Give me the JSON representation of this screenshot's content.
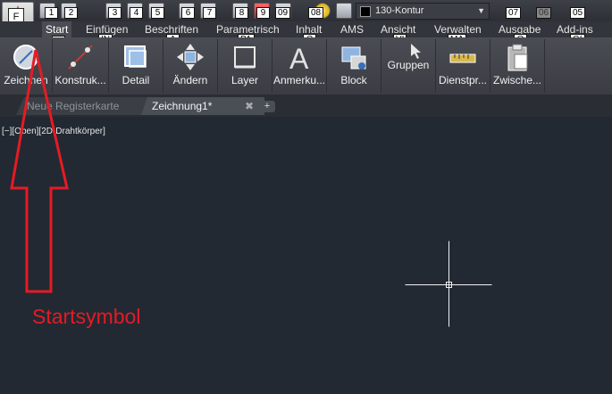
{
  "app_button": {
    "keytip": "F",
    "sub_keytip": "M"
  },
  "qat": {
    "keytips": [
      "1",
      "2",
      "3",
      "4",
      "5",
      "6",
      "7",
      "8",
      "9",
      "09",
      "08"
    ],
    "layer": {
      "name": "130-Kontur",
      "swatch": "#000000"
    },
    "right_keytips": [
      "07",
      "06",
      "05"
    ]
  },
  "ribbon": {
    "tabs": [
      {
        "label": "Start",
        "keytip": "H",
        "active": true
      },
      {
        "label": "Einfügen",
        "keytip": "IN"
      },
      {
        "label": "Beschriften",
        "keytip": "A"
      },
      {
        "label": "Parametrisch",
        "keytip": "PA"
      },
      {
        "label": "Inhalt",
        "keytip": "C"
      },
      {
        "label": "AMS"
      },
      {
        "label": "Ansicht",
        "keytip": "VI"
      },
      {
        "label": "Verwalten",
        "keytip": "MA"
      },
      {
        "label": "Ausgabe",
        "keytip": "O"
      },
      {
        "label": "Add-ins",
        "keytip": "GI"
      }
    ],
    "tools": [
      {
        "label": "Zeichnen",
        "icon": "draw-circle-icon"
      },
      {
        "label": "Konstruk...",
        "icon": "construct-line-icon"
      },
      {
        "label": "Detail",
        "icon": "detail-icon"
      },
      {
        "label": "Ändern",
        "icon": "move-arrows-icon"
      },
      {
        "label": "Layer",
        "icon": "layer-icon"
      },
      {
        "label": "Anmerku...",
        "icon": "annotation-a-icon"
      },
      {
        "label": "Block",
        "icon": "block-icon"
      },
      {
        "label": "Gruppen",
        "icon": "group-cursor-icon"
      },
      {
        "label": "Dienstpr...",
        "icon": "measure-icon"
      },
      {
        "label": "Zwische...",
        "icon": "clipboard-icon"
      }
    ]
  },
  "doc_tabs": {
    "tabs": [
      {
        "label": "Neue Registerkarte",
        "active": false
      },
      {
        "label": "Zeichnung1*",
        "active": true
      }
    ]
  },
  "viewport": {
    "label": "[−][Oben][2D-Drahtkörper]"
  },
  "annotation": {
    "label": "Startsymbol",
    "color": "#e51b24"
  },
  "colors": {
    "canvas": "#222933",
    "annotation": "#e51b24"
  }
}
